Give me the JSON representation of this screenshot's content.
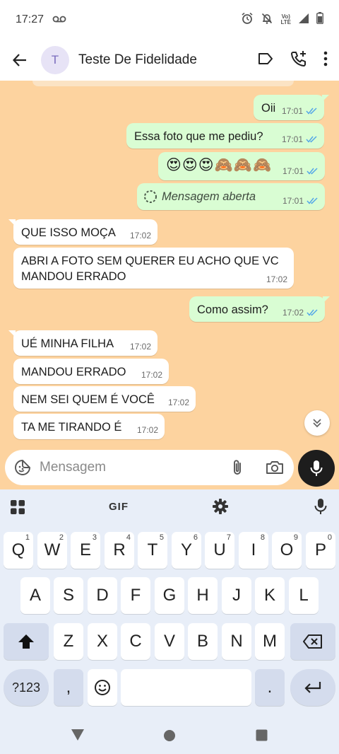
{
  "status_bar": {
    "time": "17:27",
    "lte_label_top": "Vo)",
    "lte_label_bottom": "LTE"
  },
  "header": {
    "avatar_letter": "T",
    "title": "Teste De Fidelidade"
  },
  "messages": [
    {
      "dir": "out",
      "text": "Oii",
      "time": "17:01",
      "read": true
    },
    {
      "dir": "out",
      "text": "Essa foto que me pediu?",
      "time": "17:01",
      "read": true
    },
    {
      "dir": "out",
      "text": "😍😍😍🙈🙈🙈",
      "time": "17:01",
      "read": true
    },
    {
      "dir": "out",
      "text": "Mensagem aberta",
      "time": "17:01",
      "read": true,
      "kind": "view-once-opened"
    },
    {
      "dir": "in",
      "text": "QUE ISSO MOÇA",
      "time": "17:02"
    },
    {
      "dir": "in",
      "text_line1": "ABRI A FOTO SEM QUERER EU ACHO QUE VC",
      "text_line2": "MANDOU ERRADO",
      "time": "17:02"
    },
    {
      "dir": "out",
      "text": "Como assim?",
      "time": "17:02",
      "read": true
    },
    {
      "dir": "in",
      "text": "UÉ MINHA FILHA",
      "time": "17:02"
    },
    {
      "dir": "in",
      "text": "MANDOU ERRADO",
      "time": "17:02"
    },
    {
      "dir": "in",
      "text": "NEM SEI QUEM É VOCÊ",
      "time": "17:02"
    },
    {
      "dir": "in",
      "text": "TA ME TIRANDO É",
      "time": "17:02"
    }
  ],
  "composer": {
    "placeholder": "Mensagem"
  },
  "keyboard": {
    "gif_label": "GIF",
    "row1": [
      {
        "k": "Q",
        "h": "1"
      },
      {
        "k": "W",
        "h": "2"
      },
      {
        "k": "E",
        "h": "3"
      },
      {
        "k": "R",
        "h": "4"
      },
      {
        "k": "T",
        "h": "5"
      },
      {
        "k": "Y",
        "h": "6"
      },
      {
        "k": "U",
        "h": "7"
      },
      {
        "k": "I",
        "h": "8"
      },
      {
        "k": "O",
        "h": "9"
      },
      {
        "k": "P",
        "h": "0"
      }
    ],
    "row2": [
      "A",
      "S",
      "D",
      "F",
      "G",
      "H",
      "J",
      "K",
      "L"
    ],
    "row3": [
      "Z",
      "X",
      "C",
      "V",
      "B",
      "N",
      "M"
    ],
    "symbols_label": "?123",
    "comma": ",",
    "period": "."
  },
  "colors": {
    "chat_bg": "#fdd39f",
    "outgoing": "#d9fdd3",
    "incoming": "#ffffff",
    "tick_blue": "#53a6e8"
  }
}
